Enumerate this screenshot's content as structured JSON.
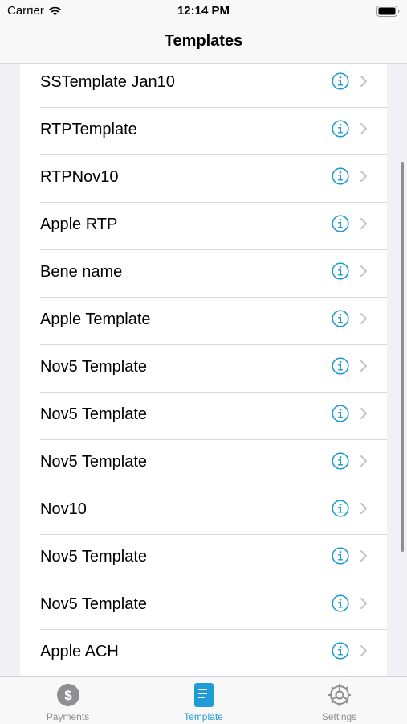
{
  "status_bar": {
    "carrier": "Carrier",
    "time": "12:14 PM"
  },
  "nav": {
    "title": "Templates"
  },
  "templates": [
    {
      "label": "SSTemplate Jan10"
    },
    {
      "label": "RTPTemplate"
    },
    {
      "label": "RTPNov10"
    },
    {
      "label": "Apple RTP"
    },
    {
      "label": "Bene name"
    },
    {
      "label": "Apple Template"
    },
    {
      "label": "Nov5 Template"
    },
    {
      "label": "Nov5 Template"
    },
    {
      "label": "Nov5 Template"
    },
    {
      "label": "Nov10"
    },
    {
      "label": "Nov5 Template"
    },
    {
      "label": "Nov5 Template"
    },
    {
      "label": "Apple ACH"
    }
  ],
  "tabs": [
    {
      "label": "Payments",
      "icon": "dollar-icon",
      "selected": false
    },
    {
      "label": "Template",
      "icon": "document-icon",
      "selected": true
    },
    {
      "label": "Settings",
      "icon": "gear-icon",
      "selected": false
    }
  ],
  "colors": {
    "accent": "#1f9bd7",
    "inactive": "#8e8e93",
    "chevron": "#c4c4c8"
  }
}
